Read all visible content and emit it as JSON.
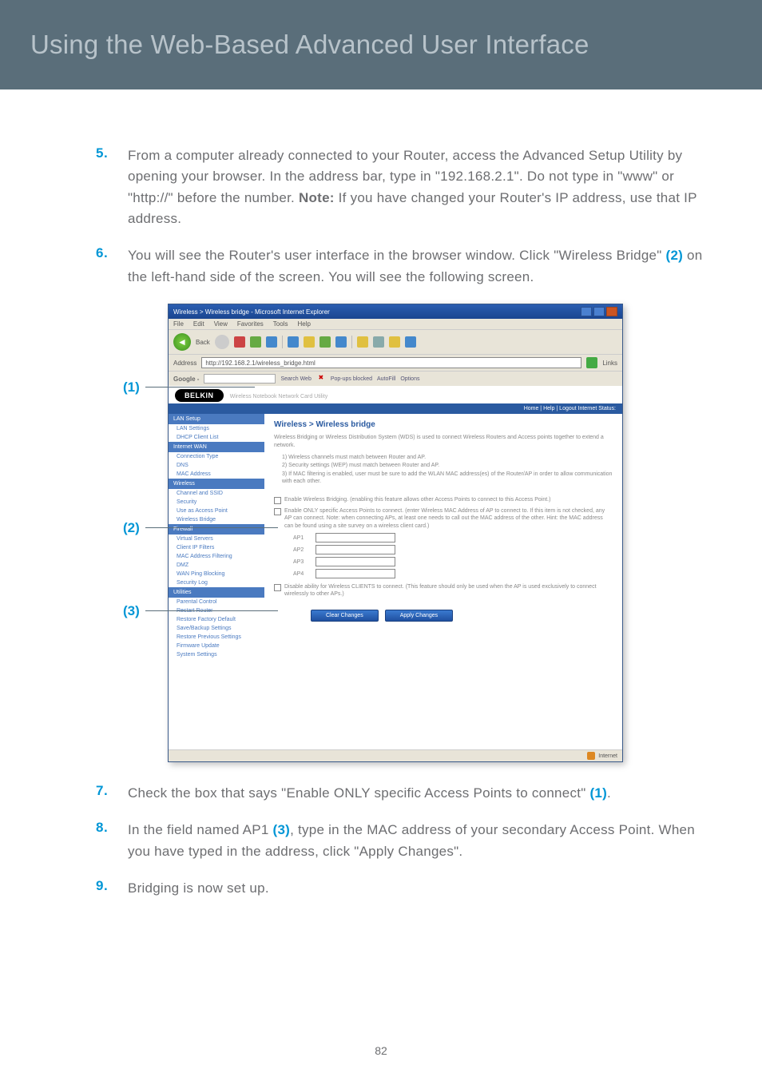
{
  "header": {
    "title": "Using the Web-Based Advanced User Interface"
  },
  "steps": {
    "s5": {
      "num": "5.",
      "text_a": "From a computer already connected to your Router, access the Advanced Setup Utility by opening your browser. In the address bar, type in \"192.168.2.1\". Do not type in \"www\" or \"http://\" before the number. ",
      "note_label": "Note:",
      "text_b": " If you have changed your Router's IP address, use that IP address."
    },
    "s6": {
      "num": "6.",
      "text_a": "You will see the Router's user interface in the browser window. Click \"Wireless Bridge\" ",
      "ref": "(2)",
      "text_b": " on the left-hand side of the screen. You will see the following screen."
    },
    "s7": {
      "num": "7.",
      "text_a": "Check the box that says \"Enable ONLY specific Access Points to connect\" ",
      "ref": "(1)",
      "text_b": "."
    },
    "s8": {
      "num": "8.",
      "text_a": "In the field named AP1 ",
      "ref": "(3)",
      "text_b": ", type in the MAC address of your secondary Access Point. When you have typed in the address, click \"Apply Changes\"."
    },
    "s9": {
      "num": "9.",
      "text": "Bridging is now set up."
    }
  },
  "callouts": {
    "c1": "(1)",
    "c2": "(2)",
    "c3": "(3)"
  },
  "browser": {
    "titlebar": "Wireless > Wireless bridge - Microsoft Internet Explorer",
    "menubar": [
      "File",
      "Edit",
      "View",
      "Favorites",
      "Tools",
      "Help"
    ],
    "back": "Back",
    "address_label": "Address",
    "address_value": "http://192.168.2.1/wireless_bridge.html",
    "links_label": "Links",
    "google": {
      "logo": "Google -",
      "search_btn": "Search Web",
      "blocked": "Pop-ups blocked",
      "autofill": "AutoFill",
      "options": "Options"
    },
    "belkin_logo": "BELKIN",
    "belkin_tag": "Wireless Notebook Network Card Utility",
    "subheader": "Home | Help | Logout   Internet Status:",
    "sidebar_sections": [
      {
        "title": "LAN Setup",
        "items": [
          "LAN Settings",
          "DHCP Client List"
        ]
      },
      {
        "title": "Internet WAN",
        "items": [
          "Connection Type",
          "DNS",
          "MAC Address"
        ]
      },
      {
        "title": "Wireless",
        "items": [
          "Channel and SSID",
          "Security",
          "Use as Access Point",
          "Wireless Bridge"
        ]
      },
      {
        "title": "Firewall",
        "items": [
          "Virtual Servers",
          "Client IP Filters",
          "MAC Address Filtering",
          "DMZ",
          "WAN Ping Blocking",
          "Security Log"
        ]
      },
      {
        "title": "Utilities",
        "items": [
          "Parental Control",
          "Restart Router",
          "Restore Factory Default",
          "Save/Backup Settings",
          "Restore Previous Settings",
          "Firmware Update",
          "System Settings"
        ]
      }
    ],
    "main": {
      "title": "Wireless > Wireless bridge",
      "intro": "Wireless Bridging or Wireless Distribution System (WDS) is used to connect Wireless Routers and Access points together to extend a network.",
      "rules": [
        "1) Wireless channels must match between Router and AP.",
        "2) Security settings (WEP) must match between Router and AP.",
        "3) If MAC filtering is enabled, user must be sure to add the WLAN MAC address(es) of the Router/AP in order to allow communication with each other."
      ],
      "chk1": "Enable Wireless Bridging. (enabling this feature allows other Access Points to connect to this Access Point.)",
      "chk2": "Enable ONLY specific Access Points to connect. (enter Wireless MAC Address of AP to connect to. If this item is not checked, any AP can connect. Note: when connecting APs, at least one needs to call out the MAC address of the other. Hint: the MAC address can be found using a site survey on a wireless client card.)",
      "ap_labels": [
        "AP1",
        "AP2",
        "AP3",
        "AP4"
      ],
      "chk3": "Disable ability for Wireless CLIENTS to connect. (This feature should only be used when the AP is used exclusively to connect wirelessly to other APs.)",
      "btn_clear": "Clear Changes",
      "btn_apply": "Apply Changes"
    },
    "status": "Internet"
  },
  "page_number": "82",
  "chart_data": null
}
